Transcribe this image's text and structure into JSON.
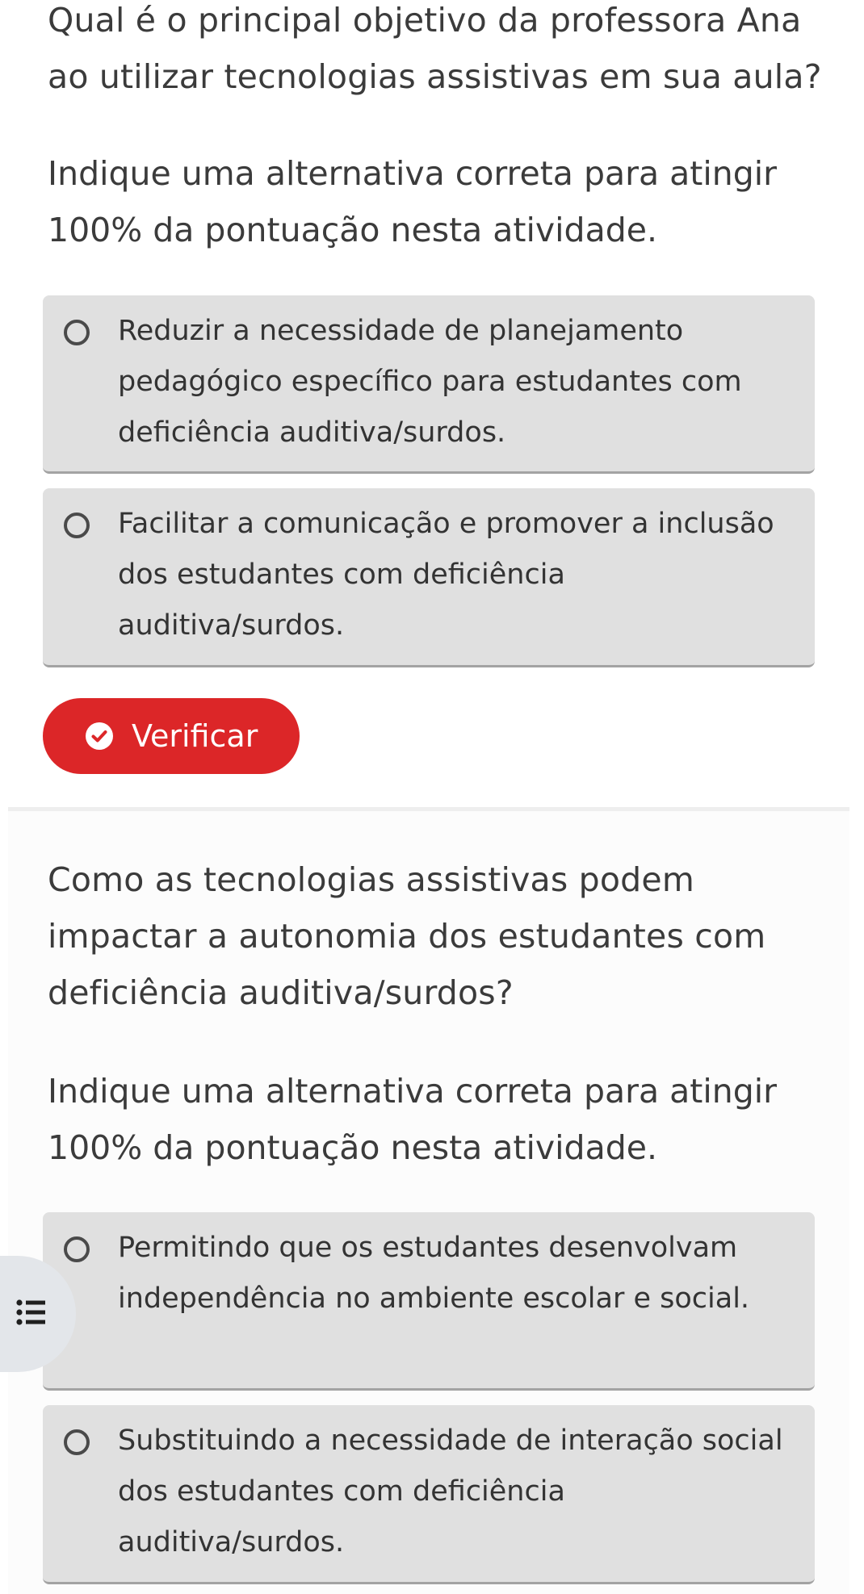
{
  "questions": [
    {
      "question": "Qual é o principal objetivo da professora Ana ao utilizar tecnologias assistivas em sua aula?",
      "instruction": "Indique uma alternativa correta para atingir 100% da pontuação nesta atividade.",
      "options": [
        {
          "label": "Reduzir a necessidade de planejamento pedagógico específico para estudantes com deficiência auditiva/surdos.",
          "selected": false
        },
        {
          "label": "Facilitar a comunicação e promover a inclusão dos estudantes com deficiência auditiva/surdos.",
          "selected": false
        }
      ],
      "verify_label": "Verificar"
    },
    {
      "question": "Como as tecnologias assistivas podem impactar a autonomia dos estudantes com deficiência auditiva/surdos?",
      "instruction": "Indique uma alternativa correta para atingir 100% da pontuação nesta atividade.",
      "options": [
        {
          "label": "Permitindo que os estudantes desenvolvam independência no ambiente escolar e social.",
          "selected": false
        },
        {
          "label": "Substituindo a necessidade de interação social dos estudantes com deficiência auditiva/surdos.",
          "selected": false
        }
      ]
    }
  ],
  "side_menu_icon": "list-icon",
  "colors": {
    "accent": "#dc2628",
    "option_bg": "#e0e0e0",
    "text": "#3b3b3b",
    "side_tab_bg": "#e3e6ea"
  }
}
